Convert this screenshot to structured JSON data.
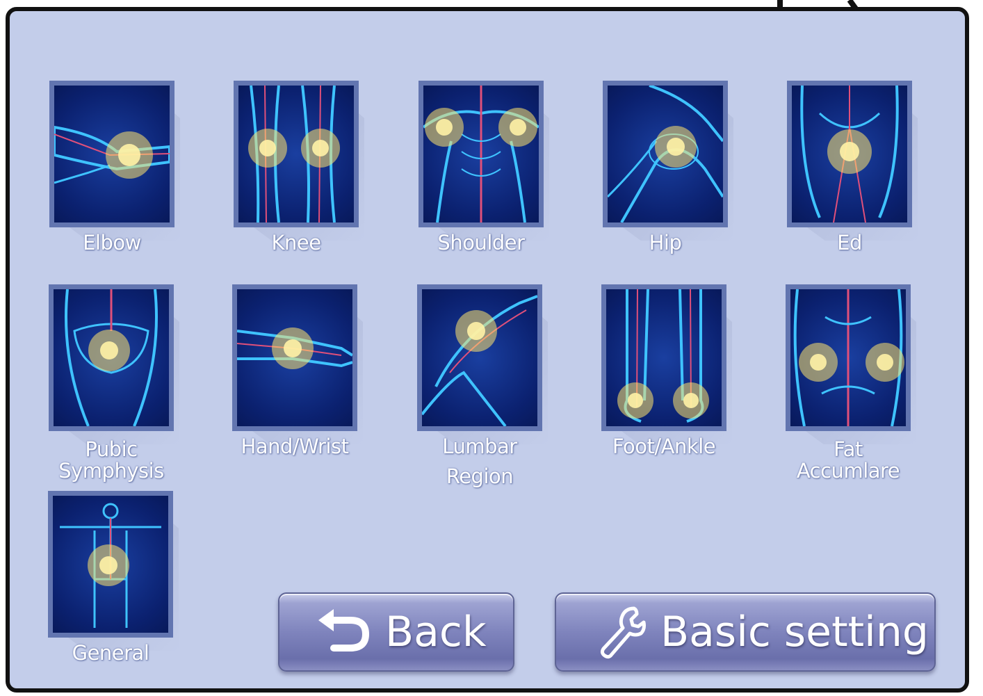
{
  "tiles": [
    {
      "label": "Elbow",
      "icon": "elbow-icon"
    },
    {
      "label": "Knee",
      "icon": "knee-icon"
    },
    {
      "label": "Shoulder",
      "icon": "shoulder-icon"
    },
    {
      "label": "Hip",
      "icon": "hip-icon"
    },
    {
      "label": "Ed",
      "icon": "ed-icon"
    },
    {
      "label_lines": [
        "Pubic",
        "Symphysis"
      ],
      "icon": "pubic-symphysis-icon"
    },
    {
      "label": "Hand/Wrist",
      "icon": "hand-wrist-icon"
    },
    {
      "label_lines": [
        "Lumbar",
        "Region"
      ],
      "icon": "lumbar-region-icon"
    },
    {
      "label": "Foot/Ankle",
      "icon": "foot-ankle-icon"
    },
    {
      "label_lines": [
        "Fat",
        "Accumlare"
      ],
      "icon": "fat-accumlare-icon"
    },
    {
      "label": "General",
      "icon": "general-icon"
    }
  ],
  "buttons": {
    "back_label": "Back",
    "back_icon": "undo-arrow-icon",
    "settings_label": "Basic setting",
    "settings_icon": "wrench-icon"
  },
  "colors": {
    "panel_background": "#c3cdea",
    "tile_border": "#6275b0",
    "tile_background": "#0b2170",
    "anatomy_glow": "#ffe36b",
    "anatomy_lines": "#3fc3ff",
    "button_fill": "#7f84bd"
  }
}
